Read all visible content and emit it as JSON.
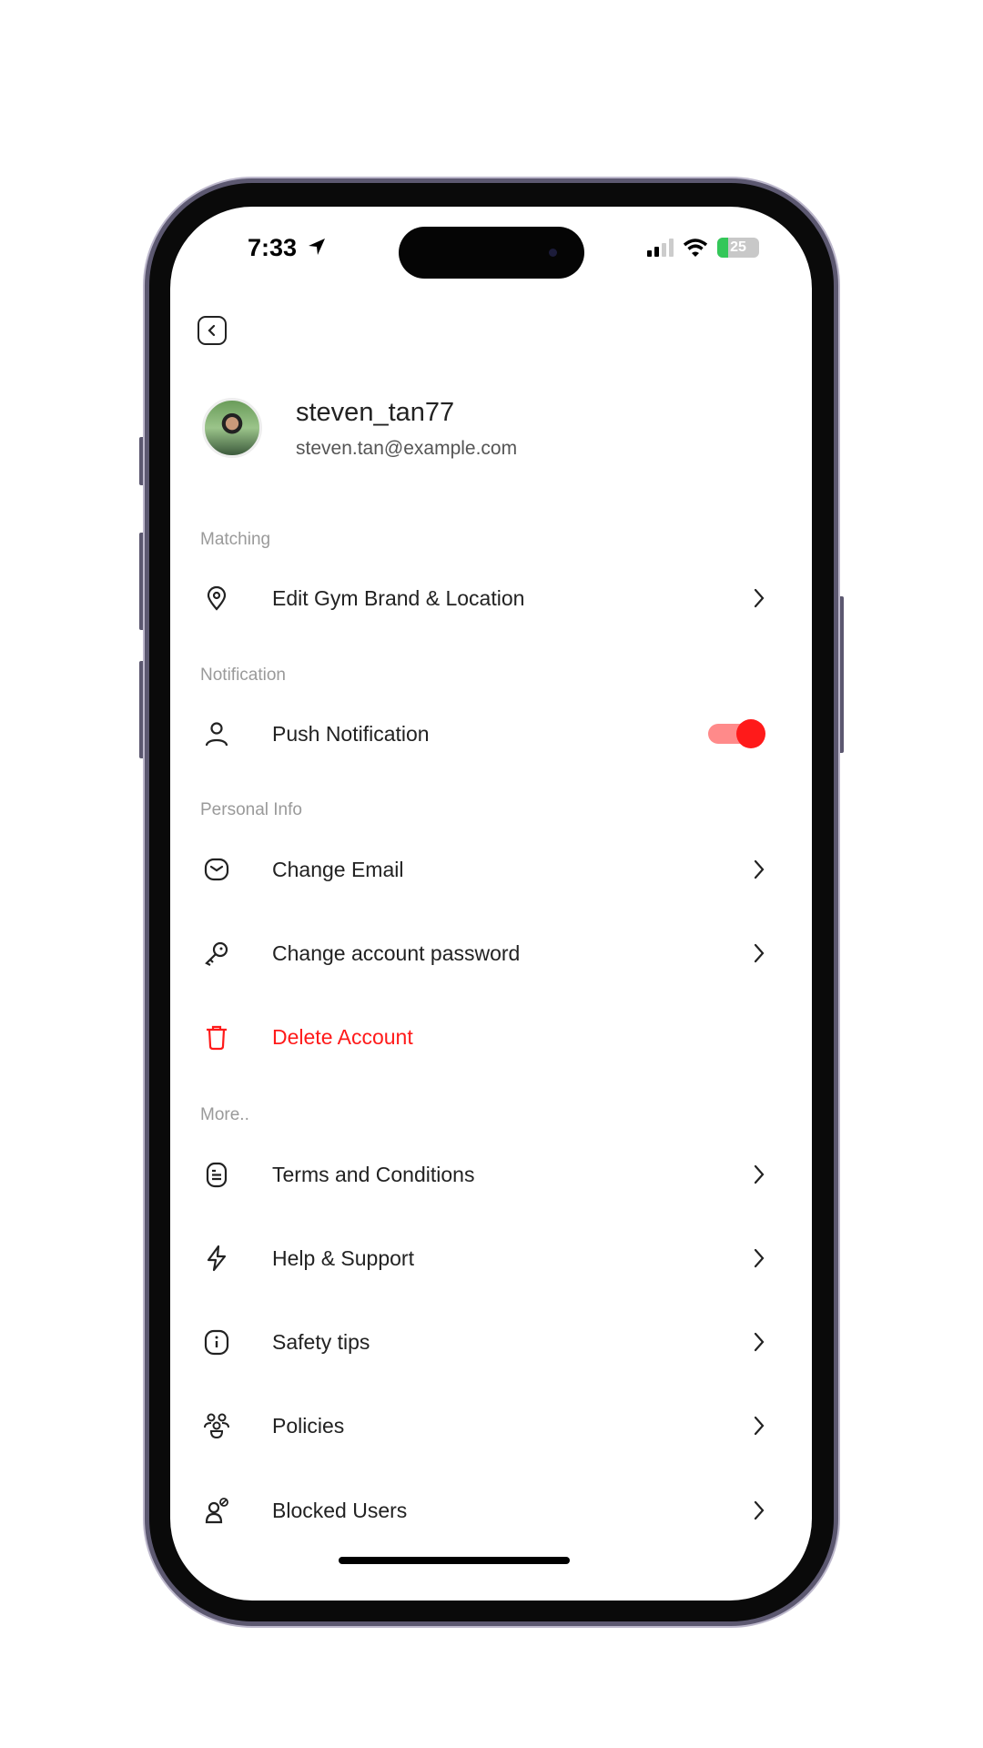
{
  "status_bar": {
    "time": "7:33",
    "battery": "25"
  },
  "profile": {
    "username": "steven_tan77",
    "email": "steven.tan@example.com"
  },
  "sections": [
    {
      "title": "Matching",
      "items": [
        {
          "label": "Edit Gym Brand & Location",
          "icon": "location-pin-icon"
        }
      ]
    },
    {
      "title": "Notification",
      "items": [
        {
          "label": "Push Notification",
          "icon": "user-icon",
          "toggle": true
        }
      ]
    },
    {
      "title": "Personal Info",
      "items": [
        {
          "label": "Change Email",
          "icon": "mail-icon"
        },
        {
          "label": "Change account password",
          "icon": "key-icon"
        },
        {
          "label": "Delete Account",
          "icon": "trash-icon",
          "danger": true
        }
      ]
    },
    {
      "title": "More..",
      "items": [
        {
          "label": "Terms and Conditions",
          "icon": "document-icon"
        },
        {
          "label": "Help & Support",
          "icon": "lightning-icon"
        },
        {
          "label": "Safety tips",
          "icon": "info-icon"
        },
        {
          "label": "Policies",
          "icon": "group-icon"
        },
        {
          "label": "Blocked Users",
          "icon": "blocked-user-icon"
        }
      ]
    }
  ],
  "colors": {
    "accent": "#ff1a1a",
    "toggle_track": "#ff8a8a",
    "section": "#9a9a9a",
    "text": "#222222"
  }
}
